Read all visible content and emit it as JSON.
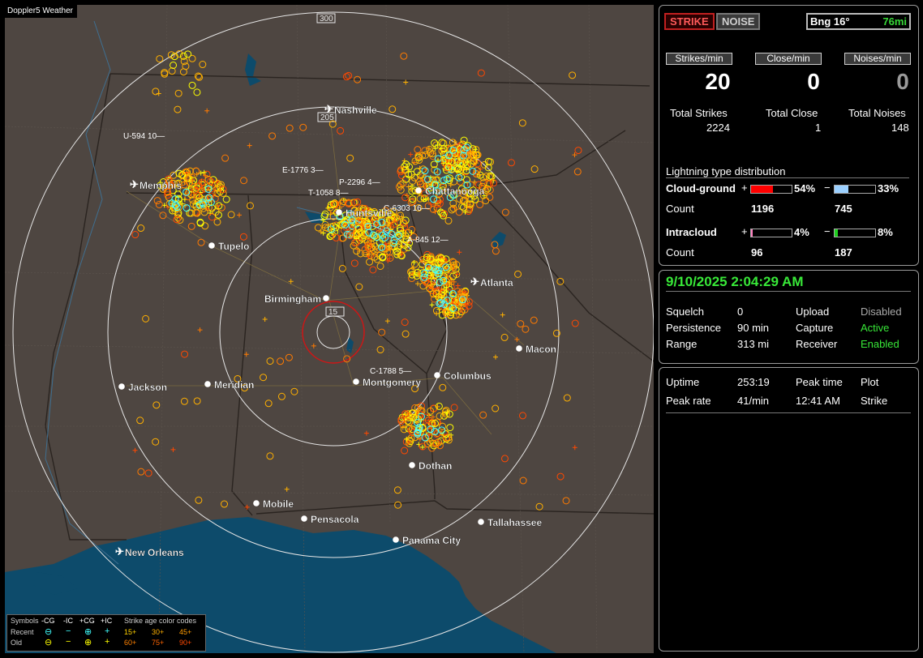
{
  "brand": "Doppler5 Weather",
  "map": {
    "range_rings": [
      {
        "label": "15"
      },
      {
        "label": "205"
      },
      {
        "label": "300"
      }
    ],
    "cities": [
      {
        "name": "Nashville",
        "airport": true
      },
      {
        "name": "Memphis",
        "airport": true
      },
      {
        "name": "Chattanooga",
        "airport": false
      },
      {
        "name": "Huntsville",
        "airport": false
      },
      {
        "name": "Tupelo",
        "airport": false
      },
      {
        "name": "Atlanta",
        "airport": true
      },
      {
        "name": "Birmingham",
        "airport": false
      },
      {
        "name": "Macon",
        "airport": false
      },
      {
        "name": "Jackson",
        "airport": false
      },
      {
        "name": "Meridian",
        "airport": false
      },
      {
        "name": "Montgomery",
        "airport": false
      },
      {
        "name": "Columbus",
        "airport": false
      },
      {
        "name": "Dothan",
        "airport": false
      },
      {
        "name": "Mobile",
        "airport": false
      },
      {
        "name": "Pensacola",
        "airport": false
      },
      {
        "name": "Tallahassee",
        "airport": false
      },
      {
        "name": "Panama City",
        "airport": false
      },
      {
        "name": "New Orleans",
        "airport": true
      }
    ],
    "storm_tags": [
      "U-594 10",
      "E-1776 3",
      "P-2296 4",
      "T-1058 8",
      "C-6303 16",
      "A-845 12",
      "C-1788 5"
    ],
    "colors": {
      "land": "#4e4641",
      "water": "#0d4b6b",
      "rings": "#e6e6e6",
      "near_ring": "#d01515",
      "recent": "#ffff00",
      "mid": "#ffb000",
      "old": "#ff7a00",
      "oldest": "#ff4800",
      "ic": "#40ffff"
    }
  },
  "legend": {
    "symbols_label": "Symbols",
    "headers": [
      "-CG",
      "-IC",
      "+CG",
      "+IC"
    ],
    "rows": [
      "Recent",
      "Old"
    ],
    "age_title": "Strike age color codes",
    "age_codes": [
      "15+",
      "30+",
      "45+",
      "60+",
      "75+",
      "90+"
    ]
  },
  "panel": {
    "strike_button": "STRIKE",
    "noise_button": "NOISE",
    "bearing_label": "Bng 16°",
    "bearing_distance": "76mi",
    "rates": [
      {
        "label": "Strikes/min",
        "value": "20"
      },
      {
        "label": "Close/min",
        "value": "0"
      },
      {
        "label": "Noises/min",
        "value": "0"
      }
    ],
    "totals": [
      {
        "label": "Total Strikes",
        "value": "2224"
      },
      {
        "label": "Total Close",
        "value": "1"
      },
      {
        "label": "Total Noises",
        "value": "148"
      }
    ],
    "distribution_title": "Lightning type distribution",
    "cloud_ground": {
      "label": "Cloud-ground",
      "pos_pct": "54%",
      "neg_pct": "33%",
      "pos": 0.54,
      "neg": 0.33,
      "count_label": "Count",
      "pos_count": "1196",
      "neg_count": "745"
    },
    "intracloud": {
      "label": "Intracloud",
      "pos_pct": "4%",
      "neg_pct": "8%",
      "pos": 0.04,
      "neg": 0.08,
      "count_label": "Count",
      "pos_count": "96",
      "neg_count": "187"
    }
  },
  "status": {
    "datetime": "9/10/2025 2:04:29 AM",
    "settings": [
      {
        "k": "Squelch",
        "v": "0",
        "k2": "Upload",
        "v2": "Disabled"
      },
      {
        "k": "Persistence",
        "v": "90 min",
        "k2": "Capture",
        "v2": "Active"
      },
      {
        "k": "Range",
        "v": "313 mi",
        "k2": "Receiver",
        "v2": "Enabled"
      }
    ]
  },
  "stats": {
    "uptime_label": "Uptime",
    "uptime": "253:19",
    "peak_time_label": "Peak time",
    "plot_label": "Plot",
    "peak_rate_label": "Peak rate",
    "peak_rate": "41/min",
    "peak_time": "12:41 AM",
    "plot": "Strike"
  }
}
